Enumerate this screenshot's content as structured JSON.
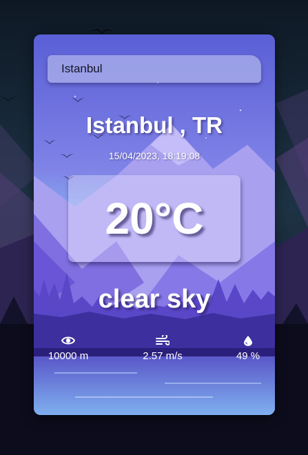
{
  "search": {
    "value": "Istanbul",
    "placeholder": ""
  },
  "location": {
    "title": "Istanbul , TR"
  },
  "datetime": "15/04/2023, 18:19:08",
  "temperature": "20°C",
  "description": "clear sky",
  "stats": {
    "visibility": {
      "icon": "eye-icon",
      "value": "10000 m"
    },
    "wind": {
      "icon": "wind-icon",
      "value": "2.57 m/s"
    },
    "humidity": {
      "icon": "droplet-icon",
      "value": "49 %"
    }
  },
  "colors": {
    "page_background": "#14202e",
    "sky_top": "#5a5fd6",
    "sky_bottom": "#8fd4f8",
    "mountain": "#a9a0f0",
    "forest": "#3d2f9e",
    "text": "#ffffff"
  }
}
